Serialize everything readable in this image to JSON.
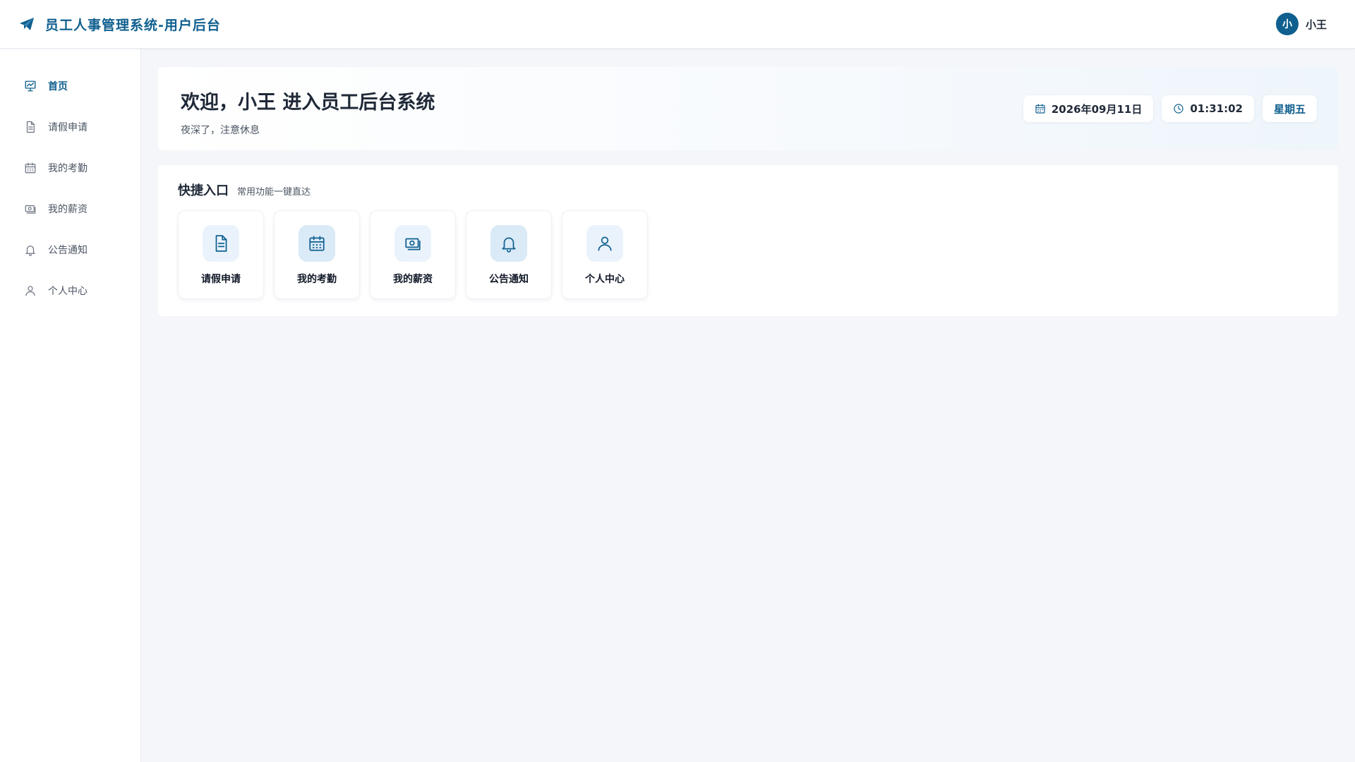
{
  "header": {
    "title": "员工人事管理系统-用户后台",
    "logo_icon": "paper-plane-icon",
    "user": {
      "avatar_text": "小",
      "name": "小王"
    }
  },
  "sidebar": {
    "items": [
      {
        "label": "首页",
        "icon": "dashboard-chart-icon",
        "active": true
      },
      {
        "label": "请假申请",
        "icon": "document-icon",
        "active": false
      },
      {
        "label": "我的考勤",
        "icon": "calendar-icon",
        "active": false
      },
      {
        "label": "我的薪资",
        "icon": "money-icon",
        "active": false
      },
      {
        "label": "公告通知",
        "icon": "bell-icon",
        "active": false
      },
      {
        "label": "个人中心",
        "icon": "user-icon",
        "active": false
      }
    ]
  },
  "welcome": {
    "title": "欢迎，小王 进入员工后台系统",
    "subtitle": "夜深了，注意休息",
    "date": "2026年09月11日",
    "time": "01:31:02",
    "weekday": "星期五"
  },
  "quick": {
    "title": "快捷入口",
    "subtitle": "常用功能一键直达",
    "tiles": [
      {
        "label": "请假申请",
        "icon": "document-icon"
      },
      {
        "label": "我的考勤",
        "icon": "calendar-icon"
      },
      {
        "label": "我的薪资",
        "icon": "money-icon"
      },
      {
        "label": "公告通知",
        "icon": "bell-icon"
      },
      {
        "label": "个人中心",
        "icon": "user-icon"
      }
    ]
  },
  "colors": {
    "brand": "#0f5f8f",
    "background": "#f4f6f9",
    "tile_icon_bg": "#eaf3fb",
    "text_dark": "#1f2937",
    "text_muted": "#4b5563"
  }
}
